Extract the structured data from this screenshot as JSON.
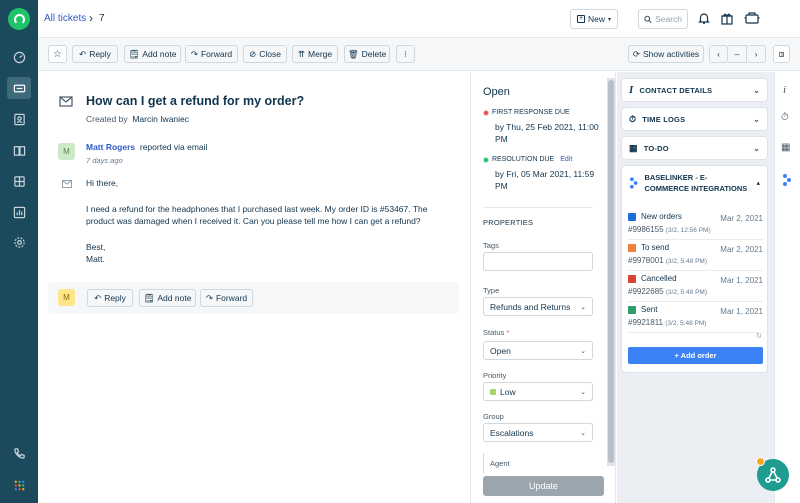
{
  "breadcrumb": {
    "link": "All tickets",
    "separator": "›",
    "ticket_number": "7"
  },
  "topbar": {
    "new_label": "New",
    "search_placeholder": "Search",
    "avatar_initial": "M"
  },
  "toolbar": {
    "reply": "Reply",
    "add_note": "Add note",
    "forward": "Forward",
    "close": "Close",
    "merge": "Merge",
    "delete": "Delete",
    "more": "⁝",
    "show_activities": "Show activities",
    "prev": "‹",
    "dash": "–",
    "next": "›"
  },
  "ticket": {
    "subject": "How can I get a refund for my order?",
    "created_by_label": "Created by",
    "created_by": "Marcin Iwaniec",
    "sender_initial": "M",
    "sender_name": "Matt Rogers",
    "sender_action": "reported via email",
    "sent_ago": "7 days ago",
    "body": [
      "Hi there,",
      "I need a refund for the headphones that I purchased last week. My order ID is #53467. The product was damaged when I received it. Can you please tell me how I can get a refund?",
      "Best,",
      "Matt."
    ]
  },
  "reply_bar": {
    "avatar_initial": "M",
    "reply": "Reply",
    "add_note": "Add note",
    "forward": "Forward"
  },
  "properties": {
    "status_title": "Open",
    "first_response_label": "FIRST RESPONSE DUE",
    "first_response_value": "by Thu, 25 Feb 2021, 11:00 PM",
    "resolution_label": "RESOLUTION DUE",
    "resolution_edit": "Edit",
    "resolution_value": "by Fri, 05 Mar 2021, 11:59 PM",
    "section_title": "PROPERTIES",
    "tags_label": "Tags",
    "tags_value": "",
    "type_label": "Type",
    "type_value": "Refunds and Returns",
    "status_label": "Status",
    "required_mark": "*",
    "status_value": "Open",
    "priority_label": "Priority",
    "priority_value": "Low",
    "group_label": "Group",
    "group_value": "Escalations",
    "agent_label": "Agent",
    "update_button": "Update"
  },
  "right_panel": {
    "contact_details": "CONTACT DETAILS",
    "time_logs": "TIME LOGS",
    "todo": "TO-DO",
    "baselinker_title": "BASELINKER - E-COMMERCE INTEGRATIONS",
    "orders": [
      {
        "status": "New orders",
        "color": "#1a6fd6",
        "date": "Mar 2, 2021",
        "number": "#9986155",
        "meta": "(3/2, 12:56 PM)"
      },
      {
        "status": "To send",
        "color": "#f0803c",
        "date": "Mar 2, 2021",
        "number": "#9978001",
        "meta": "(3/2, 5:48 PM)"
      },
      {
        "status": "Cancelled",
        "color": "#d9432f",
        "date": "Mar 1, 2021",
        "number": "#9922685",
        "meta": "(3/2, 5:48 PM)"
      },
      {
        "status": "Sent",
        "color": "#2e9e6b",
        "date": "Mar 1, 2021",
        "number": "#9921811",
        "meta": "(3/2, 5:48 PM)"
      }
    ],
    "add_order": "+ Add order"
  },
  "colors": {
    "sidebar": "#1c4a5d",
    "accent": "#2c5cc5",
    "brand_green": "#21c36a",
    "add_order_button": "#3b82f6"
  }
}
